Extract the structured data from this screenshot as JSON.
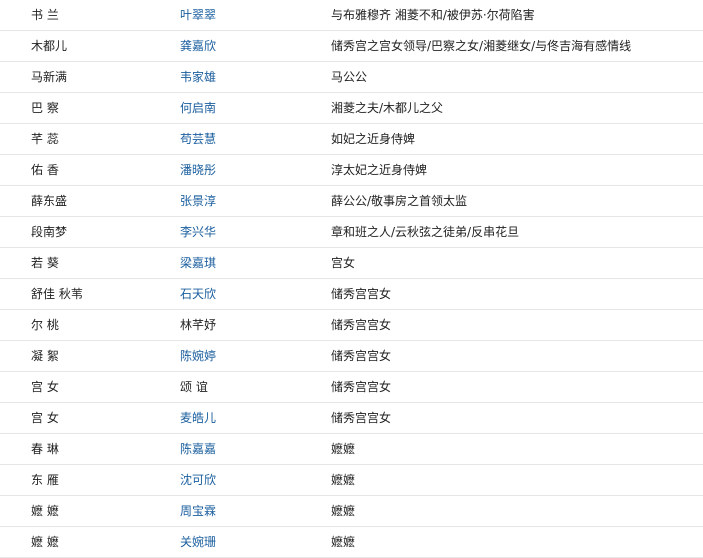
{
  "cast": [
    {
      "role": "书 兰",
      "actor": "叶翠翠",
      "actor_link": true,
      "desc": "与布雅穆齐 湘菱不和/被伊苏·尔荷陷害"
    },
    {
      "role": "木都儿",
      "actor": "龚嘉欣",
      "actor_link": true,
      "desc": "储秀宫之宫女领导/巴察之女/湘菱继女/与佟吉海有感情线"
    },
    {
      "role": "马新满",
      "actor": "韦家雄",
      "actor_link": true,
      "desc": "马公公"
    },
    {
      "role": "巴 察",
      "actor": "何启南",
      "actor_link": true,
      "desc": "湘菱之夫/木都儿之父"
    },
    {
      "role": "芊 蕊",
      "actor": "苟芸慧",
      "actor_link": true,
      "desc": "如妃之近身侍婢"
    },
    {
      "role": "佑 香",
      "actor": "潘晓彤",
      "actor_link": true,
      "desc": "淳太妃之近身侍婢"
    },
    {
      "role": "薛东盛",
      "actor": "张景淳",
      "actor_link": true,
      "desc": "薛公公/敬事房之首领太监"
    },
    {
      "role": "段南梦",
      "actor": "李兴华",
      "actor_link": true,
      "desc": "章和班之人/云秋弦之徒弟/反串花旦"
    },
    {
      "role": "若 葵",
      "actor": "梁嘉琪",
      "actor_link": true,
      "desc": "宫女"
    },
    {
      "role": "舒佳 秋苇",
      "actor": "石天欣",
      "actor_link": true,
      "desc": "储秀宫宫女"
    },
    {
      "role": "尔 桃",
      "actor": "林芊妤",
      "actor_link": false,
      "desc": "储秀宫宫女"
    },
    {
      "role": "凝 絮",
      "actor": "陈婉婷",
      "actor_link": true,
      "desc": "储秀宫宫女"
    },
    {
      "role": "宫 女",
      "actor": "颂 谊",
      "actor_link": false,
      "desc": "储秀宫宫女"
    },
    {
      "role": "宫 女",
      "actor": "麦皓儿",
      "actor_link": true,
      "desc": "储秀宫宫女"
    },
    {
      "role": "春 琳",
      "actor": "陈嘉嘉",
      "actor_link": true,
      "desc": "嬷嬷"
    },
    {
      "role": "东 雁",
      "actor": "沈可欣",
      "actor_link": true,
      "desc": "嬷嬷"
    },
    {
      "role": "嬷 嬷",
      "actor": "周宝霖",
      "actor_link": true,
      "desc": "嬷嬷"
    },
    {
      "role": "嬷 嬷",
      "actor": "关婉珊",
      "actor_link": true,
      "desc": "嬷嬷"
    }
  ]
}
